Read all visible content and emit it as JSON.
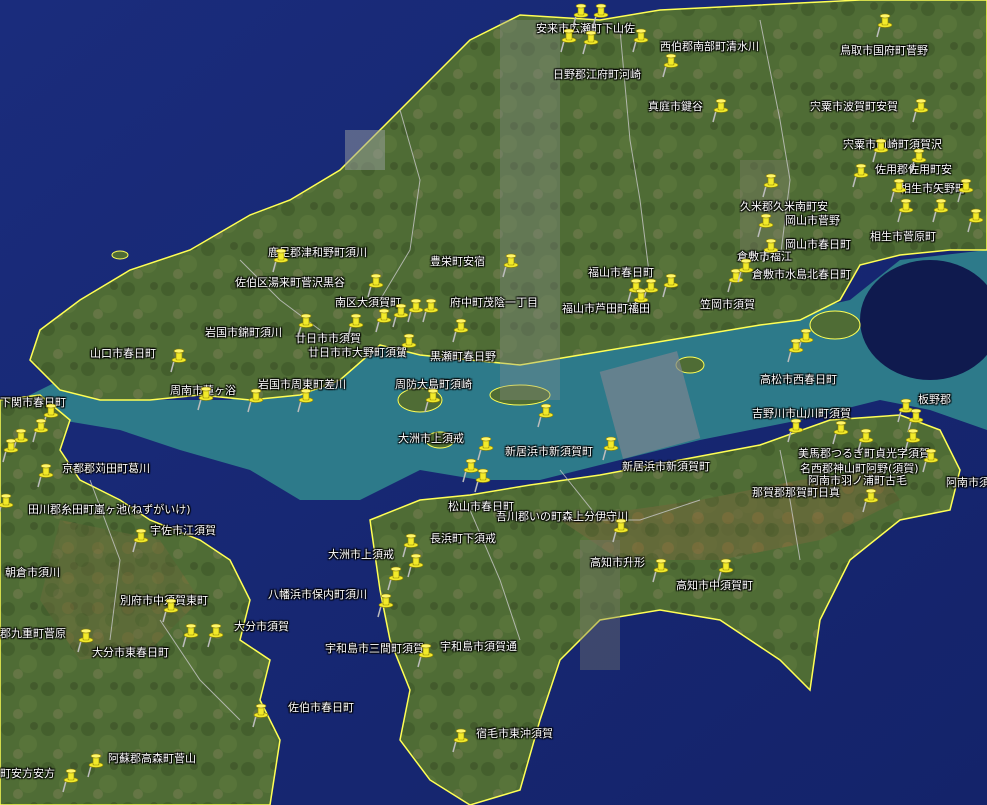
{
  "map": {
    "colors": {
      "sea_deep": "#1b2a78",
      "sea_shallow": "#2b7a8e",
      "land": "#4e6b33",
      "coast": "#ffff55",
      "border": "#c8c8c8",
      "pin": "#f2ea2a"
    },
    "pin_icon": "pushpin-icon",
    "labels": [
      {
        "id": "l1",
        "text": "安来市広瀬町下山佐"
      },
      {
        "id": "l2",
        "text": "西伯郡南部町清水川"
      },
      {
        "id": "l3",
        "text": "鳥取市国府町菅野"
      },
      {
        "id": "l4",
        "text": "日野郡江府町河崎"
      },
      {
        "id": "l5",
        "text": "真庭市鍵谷"
      },
      {
        "id": "l6",
        "text": "宍粟市波賀町安賀"
      },
      {
        "id": "l7",
        "text": "宍粟市山崎町須賀沢"
      },
      {
        "id": "l8",
        "text": "佐用郡佐用町安"
      },
      {
        "id": "l9",
        "text": "相生市矢野町"
      },
      {
        "id": "l10",
        "text": "久米郡久米南町安"
      },
      {
        "id": "l11",
        "text": "岡山市菅野"
      },
      {
        "id": "l12",
        "text": "岡山市春日町"
      },
      {
        "id": "l13",
        "text": "相生市菅原町"
      },
      {
        "id": "l14",
        "text": "倉敷市福江"
      },
      {
        "id": "l15",
        "text": "倉敷市水島北春日町"
      },
      {
        "id": "l16",
        "text": "福山市春日町"
      },
      {
        "id": "l17",
        "text": "福山市芦田町福田"
      },
      {
        "id": "l18",
        "text": "笠岡市須賀"
      },
      {
        "id": "l19",
        "text": "鹿足郡津和野町須川"
      },
      {
        "id": "l20",
        "text": "佐伯区湯来町菅沢黒谷"
      },
      {
        "id": "l21",
        "text": "豊栄町安宿"
      },
      {
        "id": "l22",
        "text": "南区大須賀町"
      },
      {
        "id": "l23",
        "text": "府中町茂陰一丁目"
      },
      {
        "id": "l24",
        "text": "岩国市錦町須川"
      },
      {
        "id": "l25",
        "text": "廿日市市須賀"
      },
      {
        "id": "l26",
        "text": "廿日市市大野町須賀"
      },
      {
        "id": "l27",
        "text": "黒瀬町春日野"
      },
      {
        "id": "l28",
        "text": "山口市春日町"
      },
      {
        "id": "l29",
        "text": "周南市蓮ヶ浴"
      },
      {
        "id": "l30",
        "text": "岩国市周東町差川"
      },
      {
        "id": "l31",
        "text": "周防大島町須崎"
      },
      {
        "id": "l32",
        "text": "高松市西春日町"
      },
      {
        "id": "l33",
        "text": "吉野川市山川町須賀"
      },
      {
        "id": "l34",
        "text": "板野郡"
      },
      {
        "id": "l35",
        "text": "下関市春日町"
      },
      {
        "id": "l36",
        "text": "大洲市上須戒"
      },
      {
        "id": "l37",
        "text": "新居浜市新須賀町"
      },
      {
        "id": "l38",
        "text": "新居浜市新須賀町"
      },
      {
        "id": "l39",
        "text": "美馬郡つるぎ町貞光字須賀"
      },
      {
        "id": "l40",
        "text": "名西郡神山町阿野(須賀)"
      },
      {
        "id": "l41",
        "text": "阿南市羽ノ浦町古毛"
      },
      {
        "id": "l42",
        "text": "阿南市須"
      },
      {
        "id": "l43",
        "text": "京都郡苅田町葛川"
      },
      {
        "id": "l44",
        "text": "田川郡糸田町嵐ヶ池(ねずがいけ)"
      },
      {
        "id": "l45",
        "text": "松山市春日町"
      },
      {
        "id": "l46",
        "text": "那賀郡那賀町日真"
      },
      {
        "id": "l47",
        "text": "吾川郡いの町森上分伊守川"
      },
      {
        "id": "l48",
        "text": "宇佐市江須賀"
      },
      {
        "id": "l49",
        "text": "長浜町下須戒"
      },
      {
        "id": "l50",
        "text": "高知市升形"
      },
      {
        "id": "l51",
        "text": "大洲市上須戒"
      },
      {
        "id": "l52",
        "text": "朝倉市須川"
      },
      {
        "id": "l53",
        "text": "高知市中須賀町"
      },
      {
        "id": "l54",
        "text": "八幡浜市保内町須川"
      },
      {
        "id": "l55",
        "text": "別府市中須賀東町"
      },
      {
        "id": "l56",
        "text": "大分市須賀"
      },
      {
        "id": "l57",
        "text": "郡九重町菅原"
      },
      {
        "id": "l58",
        "text": "大分市東春日町"
      },
      {
        "id": "l59",
        "text": "宇和島市須賀通"
      },
      {
        "id": "l60",
        "text": "宇和島市三間町須賀"
      },
      {
        "id": "l61",
        "text": "佐伯市春日町"
      },
      {
        "id": "l62",
        "text": "宿毛市東沖須賀"
      },
      {
        "id": "l63",
        "text": "阿蘇郡高森町菅山"
      },
      {
        "id": "l64",
        "text": "町安方安方"
      }
    ]
  }
}
